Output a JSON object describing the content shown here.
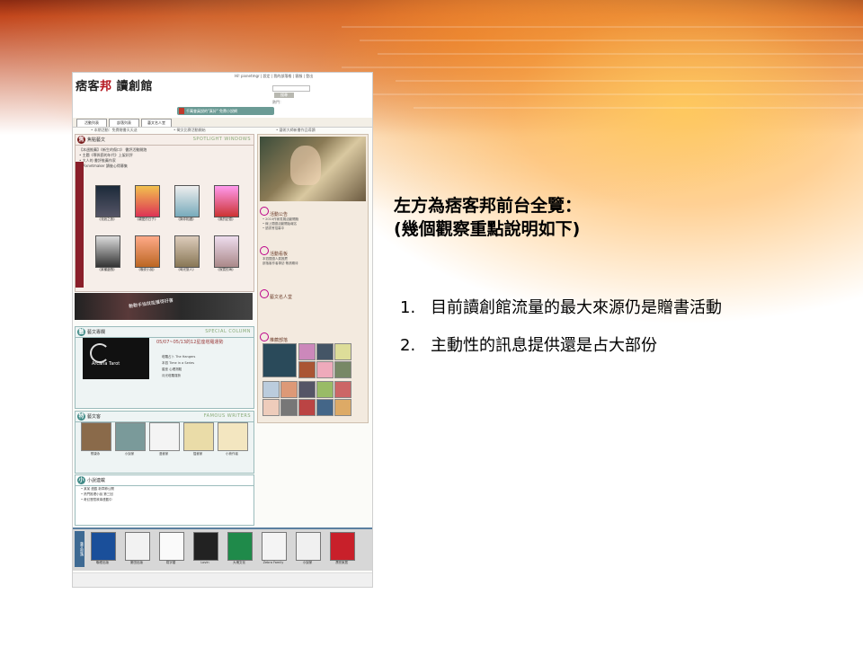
{
  "slide": {
    "heading_line1": "左方為痞客邦前台全覽：",
    "heading_line2": "(幾個觀察重點說明如下)",
    "points": [
      {
        "num": "1.",
        "text": "目前讀創館流量的最大來源仍是贈書活動"
      },
      {
        "num": "2.",
        "text": "主動性的訊息提供還是占大部份"
      }
    ]
  },
  "screenshot": {
    "logo_prefix": "痞客",
    "logo_highlight": "邦",
    "logo_suffix": " 讀創館",
    "top_links": "Hi! pixnetmgr | 設定 | 我的部落格 | 客服 | 登出",
    "search_button": "搜尋",
    "hot_link": "熱門：",
    "banner": "千萬會員說的\"真好\" 免費小說網",
    "tabs": [
      "活動列表",
      "部落列表",
      "藝文名人堂"
    ],
    "crumbs": [
      "• 本期活動：免費贈書天天送",
      "• 徵文比賽活動開始",
      "• 藝術大師新書作品導讀"
    ],
    "featured": {
      "badge": "焦",
      "title": "焦點藝文",
      "en": "SPOTLIGHT WINDOWS",
      "lines": [
        "【本週推薦】《新生的傷口》 書評活動開跑",
        "• 主題《罪與罰的年代》上架好評",
        "• 大人的 書評推薦作家",
        "• Pixnetmaker 讀後心得募集"
      ],
      "books": [
        "《流浪之旅》",
        "《親愛的日子》",
        "《與你相遇》",
        "《風的記憶》",
        "《某種遊戲》",
        "《晚安小說》",
        "《時光旅人》",
        "《寂寞的海》"
      ]
    },
    "promo": "動動手指就能獲得好書",
    "right": {
      "box1": "活動公告",
      "box1_lines": [
        "• 2010作家書展活動開跑",
        "• 線上閱讀活動開始報名",
        "• 讀書會招募中"
      ],
      "box2": "活動看板",
      "box2_lines": [
        "本週閱讀人氣推薦",
        "部落客作者專訪 敬請期待"
      ],
      "box3": "藝文名人堂",
      "box4": "推薦部落"
    },
    "column": {
      "badge": "藝",
      "title": "藝文專欄",
      "en": "SPECIAL COLUMN",
      "img_text": "Arcana Tarot",
      "heading": "05/07~05/13的12星座塔羅運勢",
      "items": [
        "塔羅占卜 The Hangers",
        "本週 Time in a Series",
        "星座 心理測驗",
        "月光塔羅運勢"
      ]
    },
    "famous": {
      "badge": "特",
      "title": "藝文客",
      "en": "FAMOUS WRITERS",
      "people": [
        "蔡康永",
        "小說家",
        "漫畫家",
        "插畫家",
        "小熊作者"
      ]
    },
    "novels": {
      "badge": "小",
      "title": "小說連載",
      "items": [
        "• 某某 連載 新章節公開",
        "• 熱門推理小說 第三回",
        "• 奇幻冒險故事連載中"
      ]
    },
    "publishers_label": "藝文部落",
    "publishers": [
      "聯經出版",
      "麥田出版",
      "寫字樓",
      "Lovin",
      "大塊文化",
      "Zebra Family",
      "小說家",
      "漂亮家居"
    ]
  }
}
